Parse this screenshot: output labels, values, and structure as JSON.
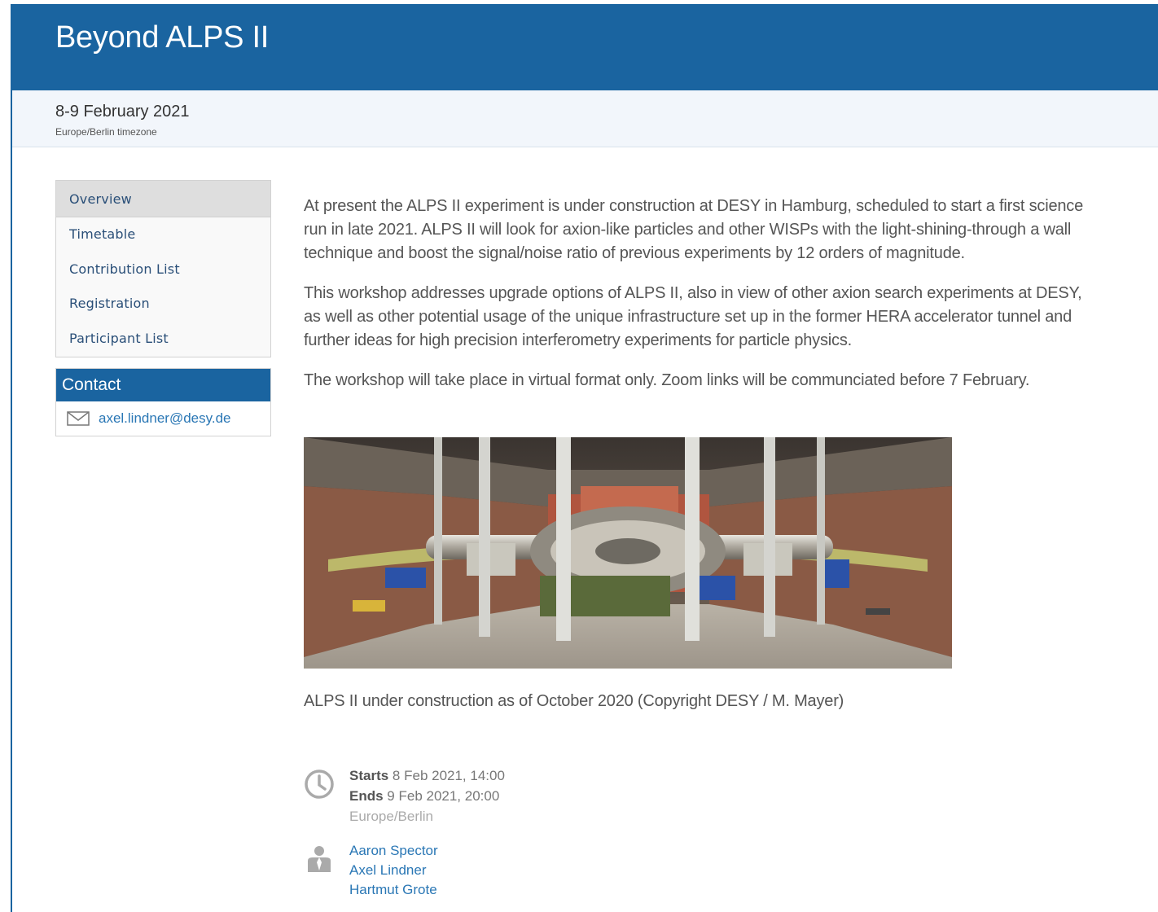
{
  "header": {
    "title": "Beyond ALPS II"
  },
  "subheader": {
    "date": "8-9 February 2021",
    "timezone": "Europe/Berlin timezone"
  },
  "menu": {
    "items": [
      {
        "label": "Overview",
        "active": true
      },
      {
        "label": "Timetable"
      },
      {
        "label": "Contribution List"
      },
      {
        "label": "Registration"
      },
      {
        "label": "Participant List"
      }
    ]
  },
  "contact": {
    "heading": "Contact",
    "email": "axel.lindner@desy.de",
    "icon": "envelope-icon"
  },
  "content": {
    "paragraphs": [
      "At present the ALPS II experiment is under construction at DESY in Hamburg, scheduled to start a first science run in late 2021. ALPS II will look for axion-like particles and other WISPs with the light-shining-through a wall technique and boost the signal/noise ratio of previous experiments by 12 orders of magnitude.",
      "This workshop addresses upgrade options of ALPS II, also in view of other axion search experiments at DESY, as well as other potential usage of the unique infrastructure set up in the former HERA accelerator tunnel and further ideas for high precision interferometry experiments for particle physics.",
      "The workshop will take place in virtual format only. Zoom links will be communciated before 7 February."
    ],
    "caption": "ALPS II under construction as of October 2020 (Copyright DESY / M. Mayer)"
  },
  "schedule": {
    "starts_label": "Starts",
    "starts_value": "8 Feb 2021, 14:00",
    "ends_label": "Ends",
    "ends_value": "9 Feb 2021, 20:00",
    "timezone": "Europe/Berlin",
    "icon": "clock-icon"
  },
  "chairpersons": {
    "icon": "person-icon",
    "names": [
      "Aaron Spector",
      "Axel Lindner",
      "Hartmut Grote"
    ]
  },
  "colors": {
    "brand": "#1a64a0",
    "link": "#2a77b5",
    "menu_text": "#2a4f78"
  }
}
